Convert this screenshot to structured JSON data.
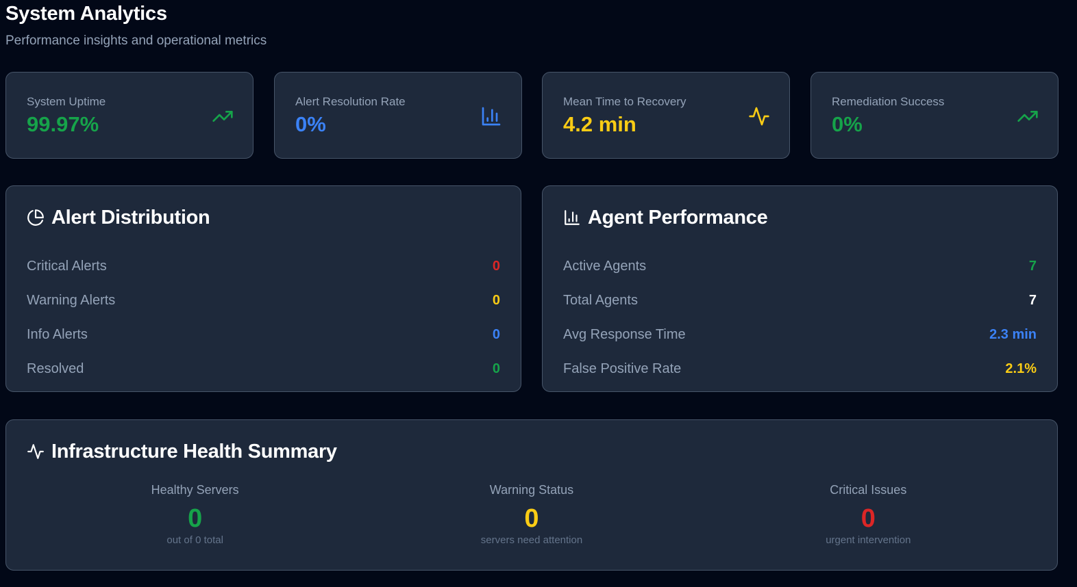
{
  "header": {
    "title": "System Analytics",
    "subtitle": "Performance insights and operational metrics"
  },
  "stats": [
    {
      "label": "System Uptime",
      "value": "99.97%",
      "icon": "trending-up-icon",
      "color": "#16a34a"
    },
    {
      "label": "Alert Resolution Rate",
      "value": "0%",
      "icon": "bar-chart-icon",
      "color": "#3b82f6"
    },
    {
      "label": "Mean Time to Recovery",
      "value": "4.2 min",
      "icon": "activity-icon",
      "color": "#facc15"
    },
    {
      "label": "Remediation Success",
      "value": "0%",
      "icon": "trending-up-icon",
      "color": "#16a34a"
    }
  ],
  "alert_distribution": {
    "title": "Alert Distribution",
    "icon": "pie-chart-icon",
    "rows": [
      {
        "label": "Critical Alerts",
        "value": "0",
        "color": "#dc2626"
      },
      {
        "label": "Warning Alerts",
        "value": "0",
        "color": "#facc15"
      },
      {
        "label": "Info Alerts",
        "value": "0",
        "color": "#3b82f6"
      },
      {
        "label": "Resolved",
        "value": "0",
        "color": "#16a34a"
      }
    ]
  },
  "agent_performance": {
    "title": "Agent Performance",
    "icon": "bar-chart-icon",
    "rows": [
      {
        "label": "Active Agents",
        "value": "7",
        "color": "#16a34a"
      },
      {
        "label": "Total Agents",
        "value": "7",
        "color": "#ffffff"
      },
      {
        "label": "Avg Response Time",
        "value": "2.3 min",
        "color": "#3b82f6"
      },
      {
        "label": "False Positive Rate",
        "value": "2.1%",
        "color": "#facc15"
      }
    ]
  },
  "infrastructure": {
    "title": "Infrastructure Health Summary",
    "icon": "activity-icon",
    "columns": [
      {
        "label": "Healthy Servers",
        "value": "0",
        "sub": "out of 0 total",
        "color": "#16a34a"
      },
      {
        "label": "Warning Status",
        "value": "0",
        "sub": "servers need attention",
        "color": "#facc15"
      },
      {
        "label": "Critical Issues",
        "value": "0",
        "sub": "urgent intervention",
        "color": "#dc2626"
      }
    ]
  }
}
